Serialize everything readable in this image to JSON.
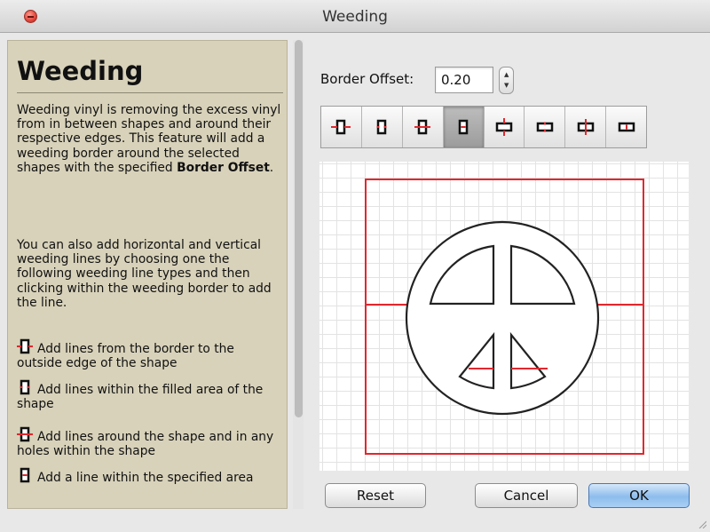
{
  "window": {
    "title": "Weeding"
  },
  "help": {
    "heading": "Weeding",
    "para1_text": "Weeding vinyl is removing the excess vinyl from in between shapes and around their respective edges. This feature will add a weeding border around the selected shapes with the specified ",
    "para1_bold": "Border Offset",
    "para1_end": ".",
    "para2": "You can also add horizontal and vertical weeding lines by choosing one the following weeding line types and then clicking within the weeding border to add the line.",
    "legend": [
      {
        "icon": "weed-line-border-to-edge-icon",
        "text": "Add lines from the border to the outside edge of the shape"
      },
      {
        "icon": "weed-line-filled-area-icon",
        "text": "Add lines within the filled area of the shape"
      },
      {
        "icon": "weed-line-around-shape-icon",
        "text": "Add lines around the shape and in any holes within the shape"
      },
      {
        "icon": "weed-line-specified-area-icon",
        "text": "Add a line within the specified area"
      }
    ]
  },
  "controls": {
    "border_offset_label": "Border Offset:",
    "border_offset_value": "0.20",
    "line_types": [
      {
        "name": "border-to-edge",
        "selected": false
      },
      {
        "name": "filled-area",
        "selected": false
      },
      {
        "name": "around-shape",
        "selected": false
      },
      {
        "name": "specified-area",
        "selected": true
      },
      {
        "name": "vertical-cross",
        "selected": false
      },
      {
        "name": "vertical-filled",
        "selected": false
      },
      {
        "name": "vertical-around",
        "selected": false
      },
      {
        "name": "vertical-specified",
        "selected": false
      }
    ]
  },
  "buttons": {
    "reset": "Reset",
    "cancel": "Cancel",
    "ok": "OK"
  },
  "colors": {
    "weed_line": "#e0282e",
    "help_bg": "#d8d2ba",
    "ok_button": "#8dbcec"
  }
}
